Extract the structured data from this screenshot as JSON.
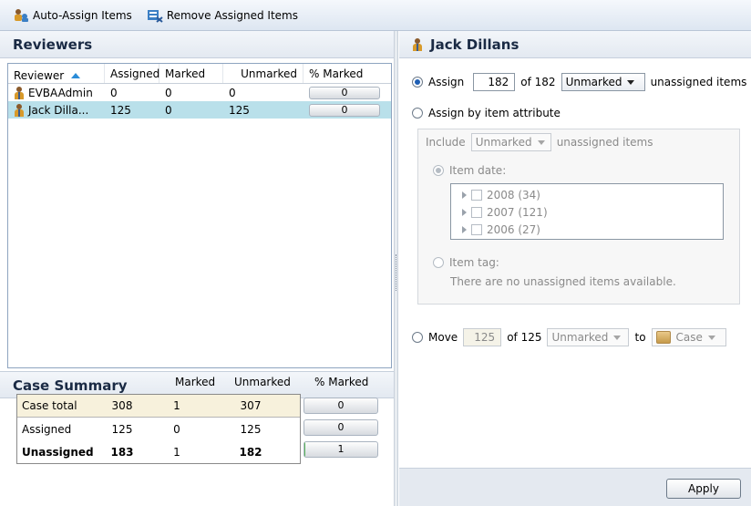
{
  "toolbar": {
    "auto_assign_label": "Auto-Assign Items",
    "remove_assigned_label": "Remove Assigned Items"
  },
  "reviewers": {
    "title": "Reviewers",
    "columns": [
      "Reviewer",
      "Assigned",
      "Marked",
      "Unmarked",
      "% Marked"
    ],
    "rows": [
      {
        "name": "EVBAAdmin",
        "assigned": "0",
        "marked": "0",
        "unmarked": "0",
        "pct": "0"
      },
      {
        "name": "Jack Dilla...",
        "assigned": "125",
        "marked": "0",
        "unmarked": "125",
        "pct": "0"
      }
    ]
  },
  "case_summary": {
    "title": "Case Summary",
    "columns": [
      "Marked",
      "Unmarked",
      "% Marked"
    ],
    "rows": [
      {
        "label": "Case total",
        "total": "308",
        "marked": "1",
        "unmarked": "307",
        "pct": "0"
      },
      {
        "label": "Assigned",
        "total": "125",
        "marked": "0",
        "unmarked": "125",
        "pct": "0"
      },
      {
        "label": "Unassigned",
        "total": "183",
        "marked": "1",
        "unmarked": "182",
        "pct": "1"
      }
    ]
  },
  "detail": {
    "title": "Jack Dillans",
    "assign": {
      "label": "Assign",
      "count": "182",
      "of_text": "of 182",
      "filter": "Unmarked",
      "suffix": "unassigned items"
    },
    "assign_attr": {
      "label": "Assign by item attribute",
      "include_label": "Include",
      "include_value": "Unmarked",
      "include_suffix": "unassigned items",
      "item_date_label": "Item date:",
      "dates": [
        "2008 (34)",
        "2007 (121)",
        "2006 (27)"
      ],
      "item_tag_label": "Item tag:",
      "item_tag_note": "There are no unassigned items available."
    },
    "move": {
      "label": "Move",
      "count": "125",
      "of_text": "of 125",
      "filter": "Unmarked",
      "to_label": "to",
      "target": "Case"
    },
    "apply_label": "Apply"
  }
}
